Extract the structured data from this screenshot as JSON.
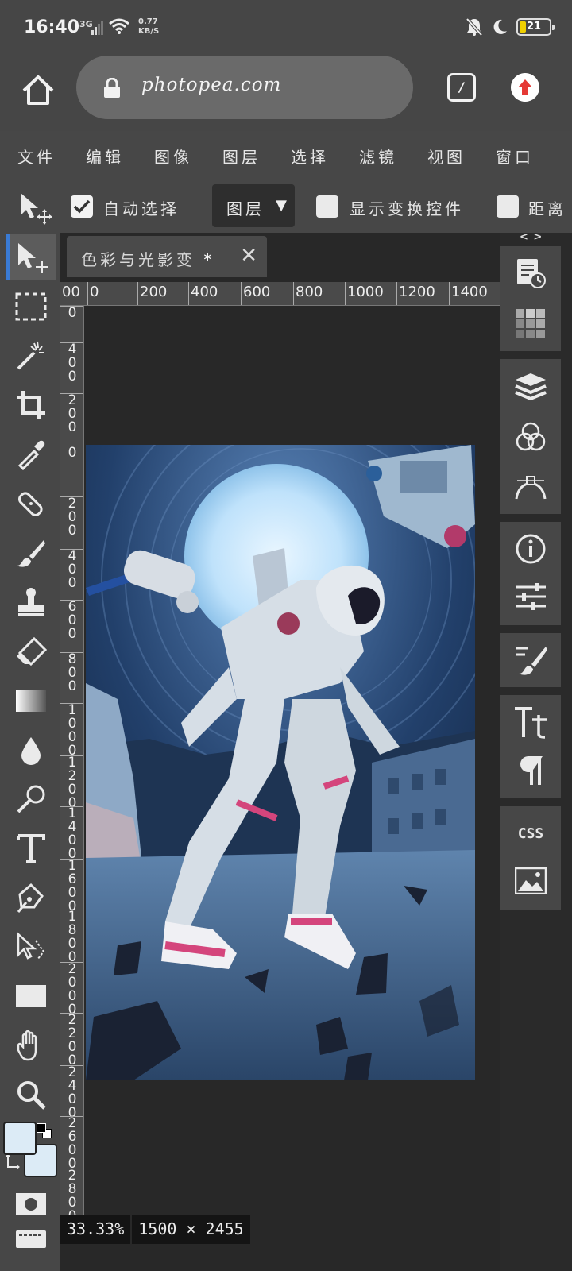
{
  "status_bar": {
    "time": "16:40",
    "network_type": "3G",
    "speed_value": "0.77",
    "speed_unit": "KB/S",
    "battery": "21"
  },
  "browser": {
    "url": "photopea.com",
    "tab_count_glyph": "/"
  },
  "menu": [
    "文件",
    "编辑",
    "图像",
    "图层",
    "选择",
    "滤镜",
    "视图",
    "窗口"
  ],
  "options_bar": {
    "auto_select_label": "自动选择",
    "auto_select_checked": true,
    "target_select_value": "图层",
    "dropdown_arrow": "▼",
    "show_transform_label": "显示变换控件",
    "distance_label": "距离"
  },
  "document": {
    "tab_title": "色彩与光影变",
    "modified_marker": "*",
    "close_glyph": "✕",
    "zoom": "33.33%",
    "dimensions": "1500 × 2455"
  },
  "rulers": {
    "horizontal": [
      "00",
      "0",
      "200",
      "400",
      "600",
      "800",
      "1000",
      "1200",
      "1400"
    ],
    "vertical": [
      "0",
      "400",
      "200",
      "0",
      "200",
      "400",
      "600",
      "800",
      "1000",
      "1200",
      "1400",
      "1600",
      "1800",
      "2000",
      "2200",
      "2400",
      "2600",
      "2800"
    ]
  },
  "right_panel": {
    "collapse_glyph": "< >",
    "css_label": "CSS"
  },
  "colors": {
    "accent": "#3a7bd5",
    "foreground_swatch": "#dcebf6",
    "background_swatch": "#dcebf6",
    "update_button": "#e53935"
  }
}
